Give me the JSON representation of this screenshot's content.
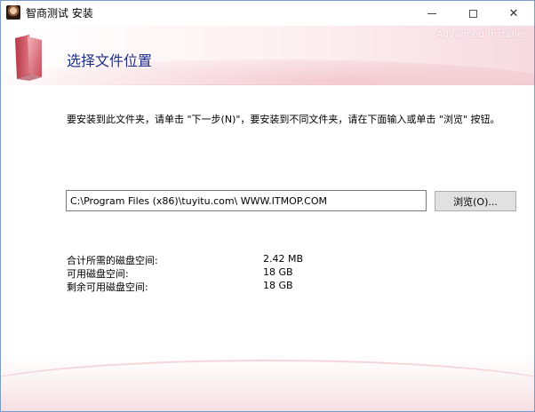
{
  "window": {
    "title": "智商测试 安装",
    "minimize_symbol": "",
    "maximize_symbol": "",
    "close_symbol": "✕"
  },
  "header": {
    "title": "选择文件位置",
    "brand": "Advanced Installer",
    "icon": "folder-icon"
  },
  "description": "要安装到此文件夹，请单击 \"下一步(N)\"，要安装到不同文件夹，请在下面输入或单击 \"浏览\" 按钮。",
  "install_path": {
    "value": "C:\\Program Files (x86)\\tuyitu.com\\ WWW.ITMOP.COM"
  },
  "browse_button": "浏览(O)...",
  "disk_space": [
    {
      "label": "合计所需的磁盘空间:",
      "value": "2.42 MB"
    },
    {
      "label": "可用磁盘空间:",
      "value": "18 GB"
    },
    {
      "label": "剩余可用磁盘空间:",
      "value": "18 GB"
    }
  ],
  "colors": {
    "header_title": "#1d2f8a",
    "accent_pink": "#f2c9d1"
  }
}
